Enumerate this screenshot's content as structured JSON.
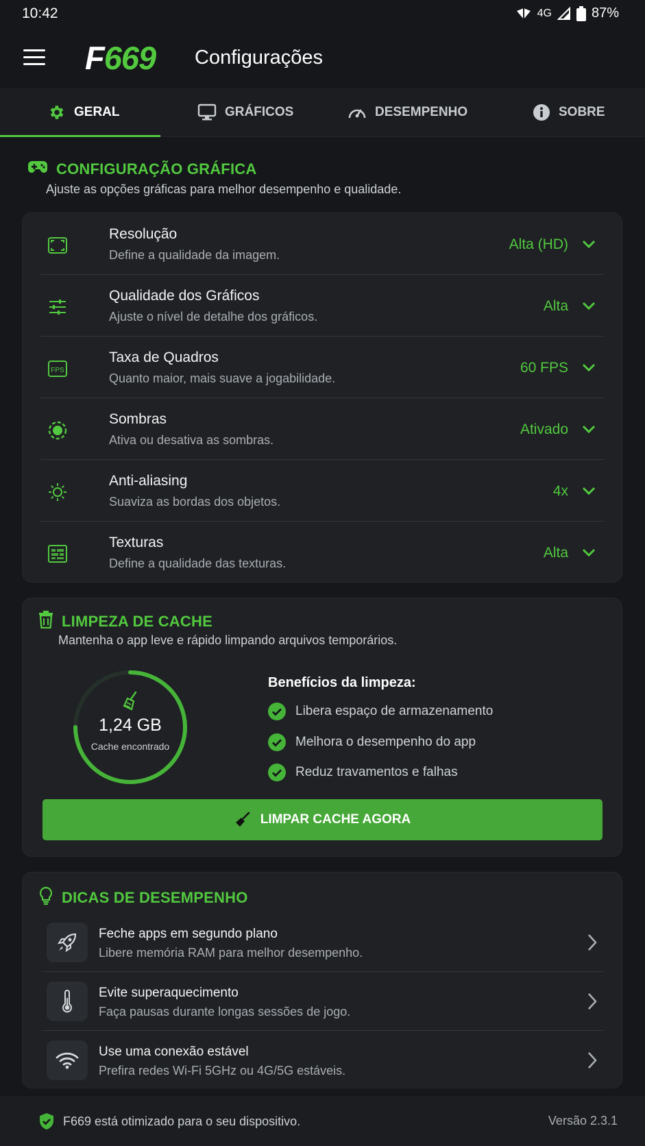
{
  "status_bar": {
    "time": "10:42",
    "network": "4G",
    "battery": "87%"
  },
  "app": {
    "logo_f": "F",
    "logo_rest": "669",
    "title": "Configurações"
  },
  "tabs": [
    {
      "label": "GERAL",
      "icon": "gear-icon",
      "active": true
    },
    {
      "label": "GRÁFICOS",
      "icon": "monitor-icon",
      "active": false
    },
    {
      "label": "DESEMPENHO",
      "icon": "speedometer-icon",
      "active": false
    },
    {
      "label": "SOBRE",
      "icon": "info-icon",
      "active": false
    }
  ],
  "graphics": {
    "title": "CONFIGURAÇÃO GRÁFICA",
    "subtitle": "Ajuste as opções gráficas para melhor desempenho e qualidade.",
    "rows": [
      {
        "label": "Resolução",
        "desc": "Define a qualidade da imagem.",
        "value": "Alta (HD)",
        "icon": "resolution-icon"
      },
      {
        "label": "Qualidade dos Gráficos",
        "desc": "Ajuste o nível de detalhe dos gráficos.",
        "value": "Alta",
        "icon": "sliders-icon"
      },
      {
        "label": "Taxa de Quadros",
        "desc": "Quanto maior, mais suave a jogabilidade.",
        "value": "60 FPS",
        "icon": "fps-icon",
        "icon_text": "FPS"
      },
      {
        "label": "Sombras",
        "desc": "Ativa ou desativa as sombras.",
        "value": "Ativado",
        "icon": "shadow-icon"
      },
      {
        "label": "Anti-aliasing",
        "desc": "Suaviza as bordas dos objetos.",
        "value": "4x",
        "icon": "sun-icon"
      },
      {
        "label": "Texturas",
        "desc": "Define a qualidade das texturas.",
        "value": "Alta",
        "icon": "texture-icon"
      }
    ]
  },
  "cache": {
    "title": "LIMPEZA DE CACHE",
    "subtitle": "Mantenha o app leve e rápido limpando arquivos temporários.",
    "amount": "1,24 GB",
    "amount_label": "Cache encontrado",
    "gauge_fraction": 0.75,
    "benefits_title": "Benefícios da limpeza:",
    "benefits": [
      "Libera espaço de armazenamento",
      "Melhora o desempenho do app",
      "Reduz travamentos e falhas"
    ],
    "button_label": "LIMPAR CACHE AGORA"
  },
  "tips": {
    "title": "DICAS DE DESEMPENHO",
    "items": [
      {
        "label": "Feche apps em segundo plano",
        "desc": "Libere memória RAM para melhor desempenho.",
        "icon": "rocket-icon"
      },
      {
        "label": "Evite superaquecimento",
        "desc": "Faça pausas durante longas sessões de jogo.",
        "icon": "thermometer-icon"
      },
      {
        "label": "Use uma conexão estável",
        "desc": "Prefira redes Wi-Fi 5GHz ou 4G/5G estáveis.",
        "icon": "wifi-icon"
      }
    ]
  },
  "footer": {
    "message": "F669 está otimizado para o seu dispositivo.",
    "version": "Versão 2.3.1"
  },
  "colors": {
    "accent": "#52c93f",
    "background": "#15171a",
    "card": "#1f2124"
  }
}
